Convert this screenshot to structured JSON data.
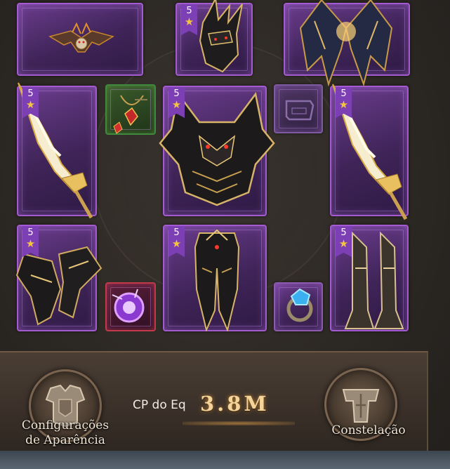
{
  "equipment": {
    "slots": [
      {
        "id": "back-ornament",
        "icon": "winged-demon-ornament-icon",
        "stars": null
      },
      {
        "id": "helmet",
        "icon": "dark-horned-helmet-icon",
        "stars": "5"
      },
      {
        "id": "wings",
        "icon": "dark-wings-icon",
        "stars": null
      },
      {
        "id": "weapon-left",
        "icon": "golden-greatsword-icon",
        "stars": "5"
      },
      {
        "id": "necklace",
        "icon": "ruby-necklace-icon",
        "stars": null
      },
      {
        "id": "chest-armor",
        "icon": "dragon-chest-armor-icon",
        "stars": "5"
      },
      {
        "id": "empty-slot",
        "icon": "empty-slot-icon",
        "stars": null
      },
      {
        "id": "weapon-right",
        "icon": "golden-greatsword-icon",
        "stars": "5"
      },
      {
        "id": "gloves",
        "icon": "dark-gauntlets-icon",
        "stars": "5"
      },
      {
        "id": "ring-purple",
        "icon": "purple-orb-ring-icon",
        "stars": null
      },
      {
        "id": "leg-armor",
        "icon": "dark-leg-armor-icon",
        "stars": "5"
      },
      {
        "id": "ring-blue",
        "icon": "blue-gem-ring-icon",
        "stars": null
      },
      {
        "id": "boots",
        "icon": "golden-boots-icon",
        "stars": "5"
      }
    ]
  },
  "footer": {
    "appearance_label_line1": "Configurações",
    "appearance_label_line2": "de Aparência",
    "cp_label": "CP do Eq",
    "cp_value": "3.8M",
    "constellation_label": "Constelação"
  },
  "colors": {
    "slot_border": "#a45ad0",
    "star": "#f3c53a",
    "cp_value": "#f4d49a"
  }
}
